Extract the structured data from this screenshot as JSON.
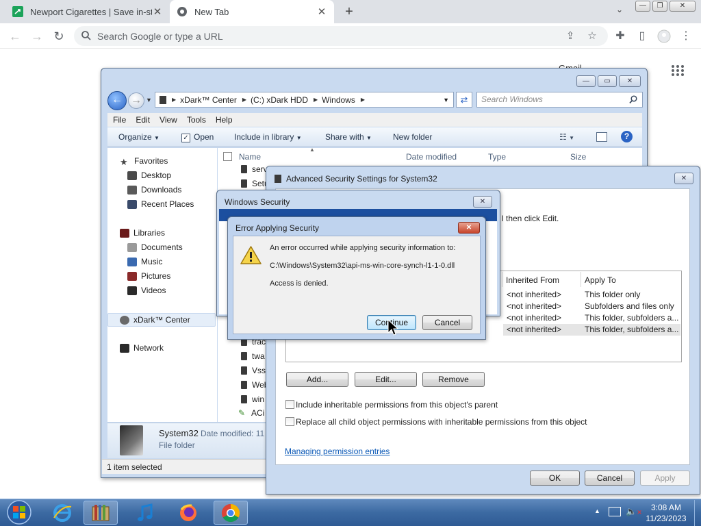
{
  "browser": {
    "tabs": [
      {
        "label": "Newport Cigarettes | Save in-store",
        "active": false
      },
      {
        "label": "New Tab",
        "active": true
      }
    ],
    "omnibox_placeholder": "Search Google or type a URL",
    "ntp_peek_text": "Gmail"
  },
  "explorer": {
    "breadcrumb": [
      "xDark™ Center",
      "(C:) xDark HDD",
      "Windows"
    ],
    "search_placeholder": "Search Windows",
    "menu": [
      "File",
      "Edit",
      "View",
      "Tools",
      "Help"
    ],
    "commands": {
      "organize": "Organize",
      "open": "Open",
      "include": "Include in library",
      "share": "Share with",
      "new_folder": "New folder"
    },
    "nav": {
      "favorites": "Favorites",
      "favorites_items": [
        "Desktop",
        "Downloads",
        "Recent Places"
      ],
      "libraries": "Libraries",
      "libraries_items": [
        "Documents",
        "Music",
        "Pictures",
        "Videos"
      ],
      "computer": "xDark™ Center",
      "network": "Network"
    },
    "columns": {
      "name": "Name",
      "date": "Date modified",
      "type": "Type",
      "size": "Size"
    },
    "files_top": [
      "serv",
      "Setu"
    ],
    "files_bottom": [
      "trac",
      "twa",
      "Vss",
      "Web",
      "win",
      "ACi"
    ],
    "details": {
      "name": "System32",
      "date_label": "Date modified: 11",
      "type": "File folder"
    },
    "status": "1 item selected"
  },
  "advanced": {
    "title": "Advanced Security Settings for System32",
    "instruction_tail": "l then click Edit.",
    "table_headers": {
      "inherited": "Inherited From",
      "apply": "Apply To"
    },
    "rows": [
      {
        "inherited": "<not inherited>",
        "apply": "This folder only"
      },
      {
        "inherited": "<not inherited>",
        "apply": "Subfolders and files only"
      },
      {
        "inherited": "<not inherited>",
        "apply": "This folder, subfolders a..."
      },
      {
        "inherited": "<not inherited>",
        "apply": "This folder, subfolders a..."
      }
    ],
    "buttons": {
      "add": "Add...",
      "edit": "Edit...",
      "remove": "Remove",
      "ok": "OK",
      "cancel": "Cancel",
      "apply": "Apply"
    },
    "checkbox_inherit": "Include inheritable permissions from this object's parent",
    "checkbox_replace": "Replace all child object permissions with inheritable permissions from this object",
    "link": "Managing permission entries"
  },
  "winsec": {
    "title": "Windows Security"
  },
  "error": {
    "title": "Error Applying Security",
    "line1": "An error occurred while applying security information to:",
    "line2": "C:\\Windows\\System32\\api-ms-win-core-synch-l1-1-0.dll",
    "line3": "Access is denied.",
    "continue": "Continue",
    "cancel": "Cancel"
  },
  "taskbar": {
    "time": "3:08 AM",
    "date": "11/23/2023"
  },
  "colors": {
    "accent": "#2a63c4",
    "chrome_tabstrip": "#dee1e6",
    "taskbar": "#3c6aa2",
    "error_red": "#c7452b"
  }
}
